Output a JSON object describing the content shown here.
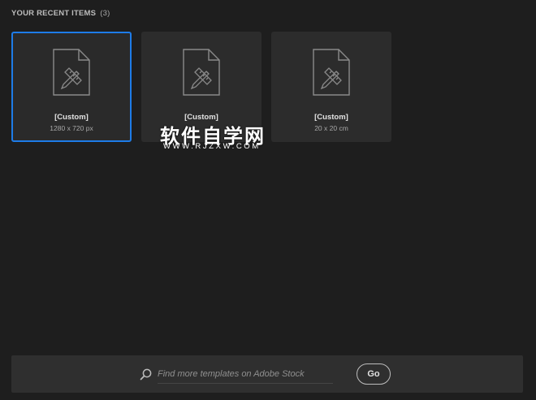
{
  "recent": {
    "title": "YOUR RECENT ITEMS",
    "count": "(3)",
    "items": [
      {
        "name": "[Custom]",
        "size": "1280 x 720 px",
        "selected": true
      },
      {
        "name": "[Custom]",
        "size": "",
        "selected": false
      },
      {
        "name": "[Custom]",
        "size": "20 x 20 cm",
        "selected": false
      }
    ]
  },
  "watermark": {
    "main": "软件自学网",
    "sub": "WWW.RJZXW.COM"
  },
  "search": {
    "placeholder": "Find more templates on Adobe Stock",
    "value": "",
    "go_label": "Go"
  },
  "colors": {
    "background": "#1e1e1e",
    "card": "#2c2c2c",
    "selected_border": "#1e7ce8",
    "search_bar": "#2f2f2f"
  }
}
